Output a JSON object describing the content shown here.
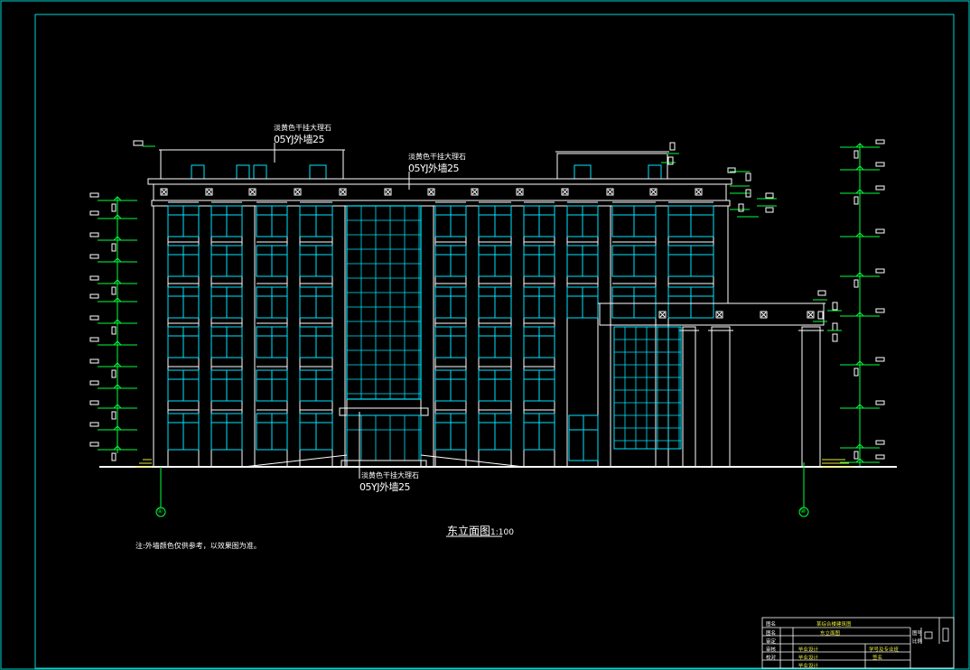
{
  "drawing": {
    "title": "东立面图",
    "title_scale": "1:100",
    "note": "注:外墙颜色仅供参考，以效果图为准。",
    "colors": {
      "background": "#000000",
      "lines": "#ffffff",
      "glazing": "#00e5ff",
      "elevation_marks": "#00ff3c",
      "frame": "#00d6d6"
    }
  },
  "annotations": [
    {
      "material": "淡黄色干挂大理石",
      "spec": "05YJ外墙25"
    },
    {
      "material": "淡黄色干挂大理石",
      "spec": "05YJ外墙25"
    },
    {
      "material": "淡黄色干挂大理石",
      "spec": "05YJ外墙25"
    }
  ],
  "axes": [
    {
      "label": "①"
    },
    {
      "label": "⑩"
    }
  ],
  "title_block": {
    "rows": [
      {
        "key": "图名",
        "value": "某综合楼建筑图"
      },
      {
        "key": "图名",
        "value": "东立面图"
      },
      {
        "key": "审定",
        "value": "毕业设计",
        "extra": "学号及专业班"
      },
      {
        "key": "审核",
        "value": "毕业设计",
        "extra": "签名"
      },
      {
        "key": "校对",
        "value": "毕业设计"
      }
    ],
    "sheet_label": "图号",
    "sheet_label2": "比例"
  }
}
